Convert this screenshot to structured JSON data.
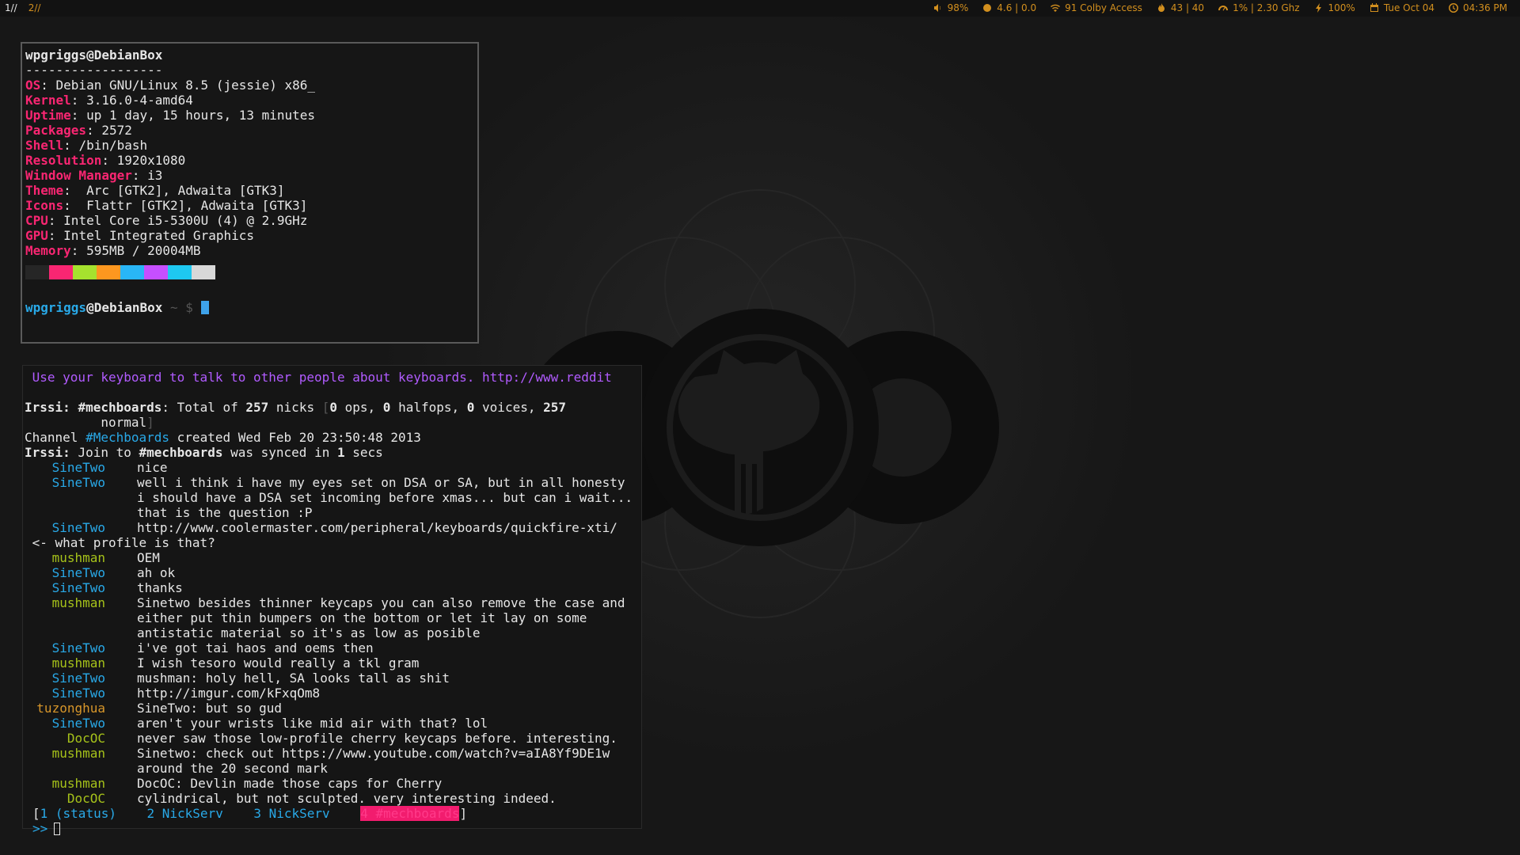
{
  "bar": {
    "workspaces": [
      "1//",
      "2//"
    ],
    "status": [
      {
        "icon": "volume-icon",
        "text": "98%"
      },
      {
        "icon": "globe-icon",
        "text": "4.6 | 0.0"
      },
      {
        "icon": "wifi-icon",
        "text": "91  Colby Access"
      },
      {
        "icon": "fire-icon",
        "text": "43 | 40"
      },
      {
        "icon": "dashboard-icon",
        "text": "1% | 2.30 Ghz"
      },
      {
        "icon": "bolt-icon",
        "text": "100%"
      },
      {
        "icon": "calendar-icon",
        "text": "Tue Oct 04"
      },
      {
        "icon": "clock-icon",
        "text": "04:36 PM"
      }
    ]
  },
  "colors": {
    "accent": "#d28f1e",
    "pink": "#f92672",
    "blue": "#29a9e8",
    "green": "#a6c21a",
    "nick_orange": "#d7962a",
    "topic_purple": "#b15bff"
  },
  "fetch": {
    "user": "wpgriggs",
    "at": "@",
    "host": "DebianBox",
    "separator": "------------------",
    "fields": [
      {
        "key": "OS",
        "value": ": Debian GNU/Linux 8.5 (jessie) x86_"
      },
      {
        "key": "Kernel",
        "value": ": 3.16.0-4-amd64"
      },
      {
        "key": "Uptime",
        "value": ": up 1 day, 15 hours, 13 minutes"
      },
      {
        "key": "Packages",
        "value": ": 2572"
      },
      {
        "key": "Shell",
        "value": ": /bin/bash"
      },
      {
        "key": "Resolution",
        "value": ": 1920x1080"
      },
      {
        "key": "Window Manager",
        "value": ": i3"
      },
      {
        "key": "Theme",
        "value": ":  Arc [GTK2], Adwaita [GTK3]"
      },
      {
        "key": "Icons",
        "value": ":  Flattr [GTK2], Adwaita [GTK3]"
      },
      {
        "key": "CPU",
        "value": ": Intel Core i5-5300U (4) @ 2.9GHz"
      },
      {
        "key": "GPU",
        "value": ": Intel Integrated Graphics"
      },
      {
        "key": "Memory",
        "value": ": 595MB / 20004MB"
      }
    ],
    "swatches": [
      "#262626",
      "#f92672",
      "#a6e22e",
      "#fd971f",
      "#29b6f6",
      "#c64fff",
      "#1ec8f0",
      "#d8d8d8"
    ],
    "prompt_user": "wpgriggs",
    "prompt_at": "@",
    "prompt_host": "DebianBox",
    "prompt_path": " ~ $ "
  },
  "irc": {
    "topic": " Use your keyboard to talk to other people about keyboards. http://www.reddit",
    "line1_pre": "Irssi: ",
    "line1_chan": "#mechboards",
    "line1_a": ": Total of ",
    "line1_n": "257",
    "line1_b": " nicks ",
    "line1_br1": "[",
    "line1_ops": "0",
    "line1_c": " ops, ",
    "line1_half": "0",
    "line1_d": " halfops, ",
    "line1_voices": "0",
    "line1_e": " voices, ",
    "line1_norm": "257",
    "line1_f": "          normal",
    "line1_br2": "]",
    "line2_a": "Channel ",
    "line2_chan": "#Mechboards",
    "line2_b": " created Wed Feb 20 23:50:48 2013",
    "line3_pre": "Irssi: ",
    "line3_a": "Join to ",
    "line3_chan": "#mechboards",
    "line3_b": " was synced in ",
    "line3_n": "1",
    "line3_c": " secs",
    "messages": [
      {
        "nick": "SineTwo",
        "text": "nice"
      },
      {
        "nick": "SineTwo",
        "text": "well i think i have my eyes set on DSA or SA, but in all honesty i should have a DSA set incoming before xmas... but can i wait... that is the question :P"
      },
      {
        "nick": "SineTwo",
        "text": "http://www.coolermaster.com/peripheral/keyboards/quickfire-xti/"
      },
      {
        "nick": "",
        "text": " <- what profile is that?"
      },
      {
        "nick": "mushman",
        "text": "OEM"
      },
      {
        "nick": "SineTwo",
        "text": "ah ok"
      },
      {
        "nick": "SineTwo",
        "text": "thanks"
      },
      {
        "nick": "mushman",
        "text": "Sinetwo besides thinner keycaps you can also remove the case and either put thin bumpers on the bottom or let it lay on some antistatic material so it's as low as posible"
      },
      {
        "nick": "SineTwo",
        "text": "i've got tai haos and oems then"
      },
      {
        "nick": "mushman",
        "text": "I wish tesoro would really a tkl gram"
      },
      {
        "nick": "SineTwo",
        "text": "mushman: holy hell, SA looks tall as shit"
      },
      {
        "nick": "SineTwo",
        "text": "http://imgur.com/kFxqOm8"
      },
      {
        "nick": "tuzonghua",
        "text": "SineTwo: but so gud"
      },
      {
        "nick": "SineTwo",
        "text": "aren't your wrists like mid air with that? lol"
      },
      {
        "nick": "DocOC",
        "text": "never saw those low-profile cherry keycaps before. interesting."
      },
      {
        "nick": "mushman",
        "text": "Sinetwo: check out https://www.youtube.com/watch?v=aIA8Yf9DE1w around the 20 second mark"
      },
      {
        "nick": "mushman",
        "text": "DocOC: Devlin made those caps for Cherry"
      },
      {
        "nick": "DocOC",
        "text": "cylindrical, but not sculpted. very interesting indeed."
      }
    ],
    "windows": [
      "1 (status)",
      "2 NickServ",
      "3 NickServ",
      "4 #mechboards"
    ],
    "bracket_open": "[",
    "bracket_close": "]",
    "prompt": ">>"
  }
}
